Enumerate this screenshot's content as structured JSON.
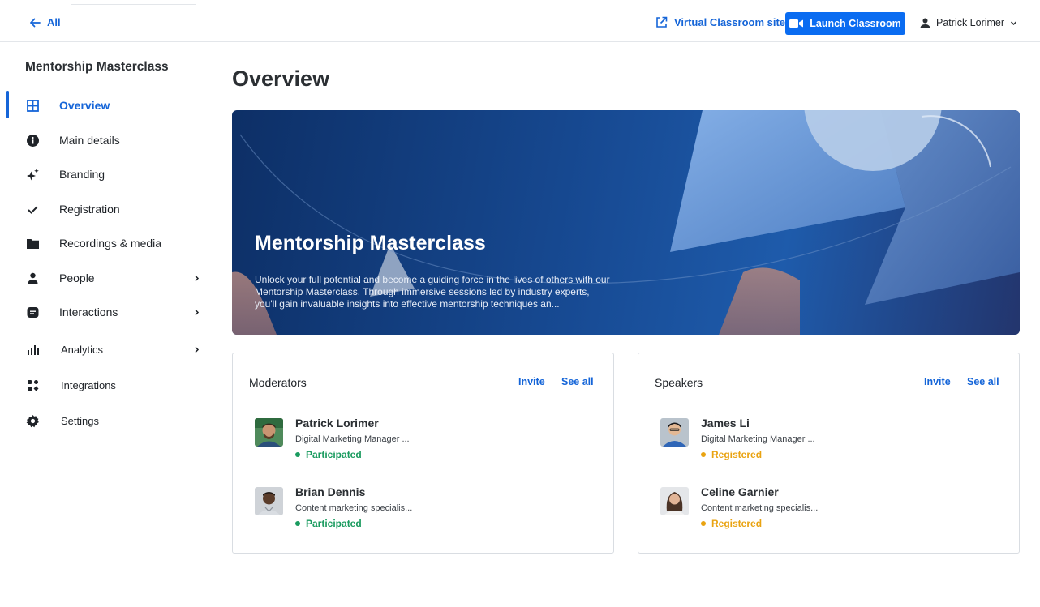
{
  "topbar": {
    "back_label": "All",
    "virtual_site_label": "Virtual Classroom site",
    "launch_label": "Launch Classroom",
    "user_name": "Patrick Lorimer",
    "accent": "#0a6cf1"
  },
  "sidebar": {
    "title": "Mentorship Masterclass",
    "items": [
      {
        "label": "Overview",
        "icon": "grid-icon",
        "active": true
      },
      {
        "label": "Main details",
        "icon": "info-icon"
      },
      {
        "label": "Branding",
        "icon": "sparkle-icon"
      },
      {
        "label": "Registration",
        "icon": "check-icon"
      },
      {
        "label": "Recordings & media",
        "icon": "folder-icon"
      },
      {
        "label": "People",
        "icon": "person-icon",
        "has_submenu": true
      },
      {
        "label": "Interactions",
        "icon": "chat-icon",
        "has_submenu": true
      },
      {
        "label": "Analytics",
        "icon": "bar-chart-icon",
        "has_submenu": true
      },
      {
        "label": "Integrations",
        "icon": "integrations-icon"
      },
      {
        "label": "Settings",
        "icon": "gear-icon"
      }
    ]
  },
  "main": {
    "title": "Overview",
    "hero": {
      "title": "Mentorship Masterclass",
      "description": "Unlock your full potential and become a guiding force in the lives of others with our Mentorship Masterclass. Through immersive sessions led by industry experts, you'll gain invaluable insights into effective mentorship techniques an..."
    },
    "moderators": {
      "title": "Moderators",
      "invite_label": "Invite",
      "see_all_label": "See all",
      "people": [
        {
          "name": "Patrick Lorimer",
          "role": "Digital Marketing Manager ...",
          "status": "Participated",
          "status_color": "#1a9b5f"
        },
        {
          "name": "Brian Dennis",
          "role": "Content marketing specialis...",
          "status": "Participated",
          "status_color": "#1a9b5f"
        }
      ]
    },
    "speakers": {
      "title": "Speakers",
      "invite_label": "Invite",
      "see_all_label": "See all",
      "people": [
        {
          "name": "James Li",
          "role": "Digital Marketing Manager ...",
          "status": "Registered",
          "status_color": "#e9a311"
        },
        {
          "name": "Celine Garnier",
          "role": "Content marketing specialis...",
          "status": "Registered",
          "status_color": "#e9a311"
        }
      ]
    }
  }
}
